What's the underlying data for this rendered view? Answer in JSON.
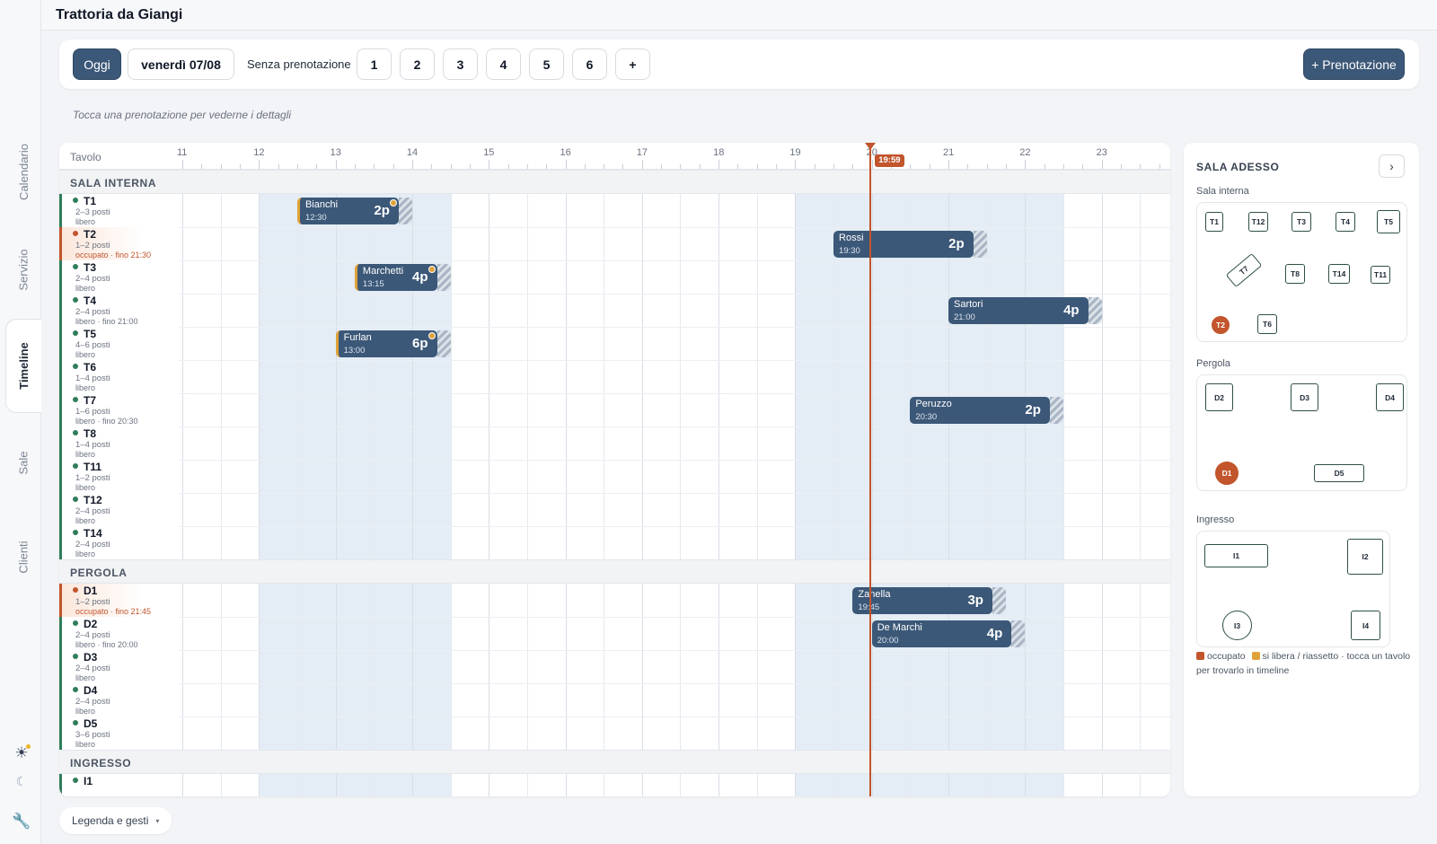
{
  "app": {
    "title": "Trattoria da Giangi"
  },
  "nav": {
    "tabs": [
      {
        "label": "Calendario",
        "active": false
      },
      {
        "label": "Servizio",
        "active": false
      },
      {
        "label": "Timeline",
        "active": true
      },
      {
        "label": "Sale",
        "active": false
      },
      {
        "label": "Clienti",
        "active": false
      }
    ]
  },
  "toolbar": {
    "today_label": "Oggi",
    "date_label": "venerdì 07/08",
    "walkin_label": "Senza prenotazione",
    "party_sizes": [
      "1",
      "2",
      "3",
      "4",
      "5",
      "6",
      "+"
    ],
    "new_booking_label": "+ Prenotazione"
  },
  "hint": "Tocca una prenotazione per vederne i dettagli",
  "timeline": {
    "column_header": "Tavolo",
    "hours": [
      "11",
      "12",
      "13",
      "14",
      "15",
      "16",
      "17",
      "18",
      "19",
      "20",
      "21",
      "22",
      "23"
    ],
    "now_label": "19:59",
    "now_hour": 19.983,
    "service_windows": [
      [
        12,
        14.5
      ],
      [
        19,
        22.5
      ]
    ],
    "sections": [
      {
        "name": "SALA INTERNA",
        "tables": [
          {
            "name": "T1",
            "capacity": "2–3 posti",
            "status": "libero",
            "occupied": false
          },
          {
            "name": "T2",
            "capacity": "1–2 posti",
            "status": "occupato · fino 21:30",
            "occupied": true
          },
          {
            "name": "T3",
            "capacity": "2–4 posti",
            "status": "libero",
            "occupied": false
          },
          {
            "name": "T4",
            "capacity": "2–4 posti",
            "status": "libero · fino 21:00",
            "occupied": false
          },
          {
            "name": "T5",
            "capacity": "4–6 posti",
            "status": "libero",
            "occupied": false
          },
          {
            "name": "T6",
            "capacity": "1–4 posti",
            "status": "libero",
            "occupied": false
          },
          {
            "name": "T7",
            "capacity": "1–6 posti",
            "status": "libero · fino 20:30",
            "occupied": false
          },
          {
            "name": "T8",
            "capacity": "1–4 posti",
            "status": "libero",
            "occupied": false
          },
          {
            "name": "T11",
            "capacity": "1–2 posti",
            "status": "libero",
            "occupied": false
          },
          {
            "name": "T12",
            "capacity": "2–4 posti",
            "status": "libero",
            "occupied": false
          },
          {
            "name": "T14",
            "capacity": "2–4 posti",
            "status": "libero",
            "occupied": false
          }
        ]
      },
      {
        "name": "PERGOLA",
        "tables": [
          {
            "name": "D1",
            "capacity": "1–2 posti",
            "status": "occupato · fino 21:45",
            "occupied": true
          },
          {
            "name": "D2",
            "capacity": "2–4 posti",
            "status": "libero · fino 20:00",
            "occupied": false
          },
          {
            "name": "D3",
            "capacity": "2–4 posti",
            "status": "libero",
            "occupied": false
          },
          {
            "name": "D4",
            "capacity": "2–4 posti",
            "status": "libero",
            "occupied": false
          },
          {
            "name": "D5",
            "capacity": "3–6 posti",
            "status": "libero",
            "occupied": false
          }
        ]
      },
      {
        "name": "INGRESSO",
        "tables": [
          {
            "name": "I1",
            "capacity": "",
            "status": "",
            "occupied": false
          }
        ]
      }
    ],
    "reservations": [
      {
        "table": "T1",
        "name": "Bianchi",
        "time": "12:30",
        "start": 12.5,
        "end": 14.0,
        "party": "2p",
        "pending": true
      },
      {
        "table": "T2",
        "name": "Rossi",
        "time": "19:30",
        "start": 19.5,
        "end": 21.5,
        "party": "2p",
        "pending": false
      },
      {
        "table": "T3",
        "name": "Marchetti",
        "time": "13:15",
        "start": 13.25,
        "end": 14.5,
        "party": "4p",
        "pending": true
      },
      {
        "table": "T4",
        "name": "Sartori",
        "time": "21:00",
        "start": 21.0,
        "end": 23.0,
        "party": "4p",
        "pending": false
      },
      {
        "table": "T5",
        "name": "Furlan",
        "time": "13:00",
        "start": 13.0,
        "end": 14.5,
        "party": "6p",
        "pending": true
      },
      {
        "table": "T7",
        "name": "Peruzzo",
        "time": "20:30",
        "start": 20.5,
        "end": 22.5,
        "party": "2p",
        "pending": false
      },
      {
        "table": "D1",
        "name": "Zanella",
        "time": "19:45",
        "start": 19.75,
        "end": 21.75,
        "party": "3p",
        "pending": false
      },
      {
        "table": "D2",
        "name": "De Marchi",
        "time": "20:00",
        "start": 20.0,
        "end": 22.0,
        "party": "4p",
        "pending": false
      }
    ]
  },
  "side": {
    "title": "SALA ADESSO",
    "zones": [
      {
        "label": "Sala interna",
        "tables": [
          "T1",
          "T12",
          "T3",
          "T4",
          "T5",
          "T7",
          "T8",
          "T14",
          "T11",
          "T2",
          "T6"
        ]
      },
      {
        "label": "Pergola",
        "tables": [
          "D2",
          "D3",
          "D4",
          "D1",
          "D5"
        ]
      },
      {
        "label": "Ingresso",
        "tables": [
          "I1",
          "I2",
          "I3",
          "I4"
        ]
      }
    ],
    "legend_occupied": "occupato",
    "legend_freeing": "si libera / riassetto · tocca un tavolo per trovarlo in timeline"
  },
  "footer": {
    "legend_label": "Legenda e gesti"
  },
  "colors": {
    "accent": "#3c5878",
    "occupied": "#c2552c",
    "pending": "#e0a23a",
    "free": "#2f7d5b"
  }
}
